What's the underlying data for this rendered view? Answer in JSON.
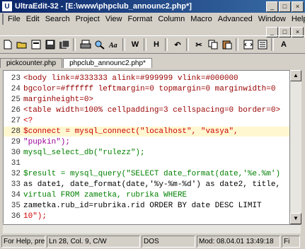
{
  "window": {
    "app_icon": "U",
    "title": "UltraEdit-32 - [E:\\www\\phpclub_announc2.php*]",
    "buttons": [
      "_",
      "□",
      "×"
    ]
  },
  "menu": {
    "items": [
      "File",
      "Edit",
      "Search",
      "Project",
      "View",
      "Format",
      "Column",
      "Macro",
      "Advanced",
      "Window",
      "Help"
    ],
    "mdi_buttons": [
      "_",
      "□",
      "×"
    ]
  },
  "toolbar": {
    "icons": [
      "new-file-icon",
      "open-folder-icon",
      "close-file-icon",
      "save-icon",
      "save-all-icon",
      "print-icon",
      "find-icon",
      "spelling-icon",
      "word-wrap-icon",
      "hex-mode-icon",
      "undo-icon",
      "cut-icon",
      "copy-icon",
      "paste-icon",
      "html-tags-icon",
      "line-numbers-icon"
    ],
    "labels": [
      "W",
      "H",
      "↶",
      "✂",
      "A"
    ]
  },
  "tabs": [
    {
      "label": "pickcounter.php",
      "active": false
    },
    {
      "label": "phpclub_announc2.php*",
      "active": true
    }
  ],
  "editor": {
    "lines": [
      {
        "num": "23",
        "text": "<body link=#333333 alink=#999999 vlink=#000000",
        "style": "tag"
      },
      {
        "num": "24",
        "text": "bgcolor=#ffffff leftmargin=0 topmargin=0 marginwidth=0",
        "style": "tag"
      },
      {
        "num": "25",
        "text": "marginheight=0>",
        "style": "tag"
      },
      {
        "num": "26",
        "text": "<table width=100% cellpadding=3 cellspacing=0 border=0>",
        "style": "tag"
      },
      {
        "num": "27",
        "text": "<?",
        "style": "red"
      },
      {
        "num": "28",
        "text": "$connect = mysql_connect(\"localhost\", \"vasya\",",
        "style": "hl"
      },
      {
        "num": "29",
        "text": "\"pupkin\");",
        "style": "pur"
      },
      {
        "num": "30",
        "text": "mysql_select_db(\"rulezz\");",
        "style": "grn"
      },
      {
        "num": "31",
        "text": "",
        "style": "plain"
      },
      {
        "num": "32",
        "text": "$result = mysql_query(\"SELECT date_format(date,'%e.%m')",
        "style": "grn"
      },
      {
        "num": "33",
        "text": "as date1, date_format(date,'%y-%m-%d') as date2, title,",
        "style": "plain"
      },
      {
        "num": "34",
        "text": "virtual FROM zametka, rubrika WHERE",
        "style": "grn"
      },
      {
        "num": "35",
        "text": "zametka.rub_id=rubrika.rid ORDER BY date DESC LIMIT",
        "style": "plain"
      },
      {
        "num": "36",
        "text": "10\");",
        "style": "red"
      }
    ]
  },
  "status": {
    "help": "For Help, press F1",
    "position": "Ln 28, Col. 9, C/W",
    "encoding": "DOS",
    "modified": "Mod: 08.04.01 13:49:18",
    "file_size": "Fi"
  }
}
